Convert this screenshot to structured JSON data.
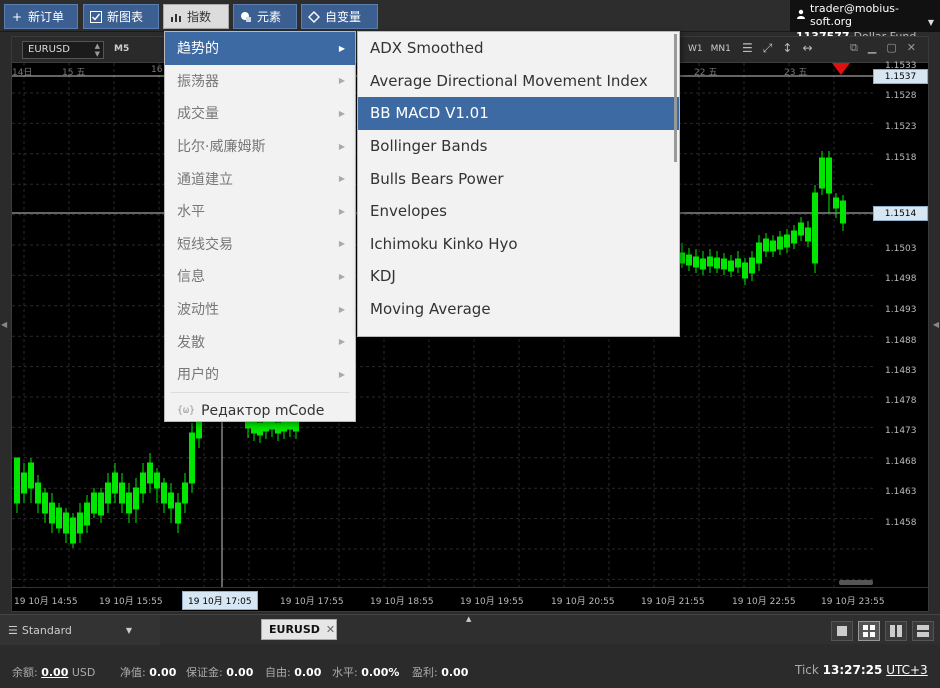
{
  "toolbar": {
    "new_order": "新订单",
    "new_chart": "新图表",
    "indicators": "指数",
    "elements": "元素",
    "variables": "自变量"
  },
  "account": {
    "email": "trader@mobius-soft.org",
    "number": "1137577",
    "fund": "Dollar Fund"
  },
  "chart": {
    "symbol": "EURUSD",
    "timeframe": "M5",
    "timeframes_right": [
      "W1",
      "MN1"
    ],
    "current_price_tag": "1.1537",
    "crosshair_price_tag": "1.1514",
    "price_labels": [
      "1.1533",
      "1.1528",
      "1.1523",
      "1.1518",
      "1.1508",
      "1.1503",
      "1.1498",
      "1.1493",
      "1.1488",
      "1.1483",
      "1.1478",
      "1.1473",
      "1.1468",
      "1.1463",
      "1.1458"
    ],
    "date_labels": [
      "14日",
      "15 五",
      "16",
      "22 五",
      "23 五"
    ],
    "time_labels": [
      "19 10月 14:55",
      "19 10月 15:55",
      "19 10月 17:05",
      "19 10月 17:55",
      "19 10月 18:55",
      "19 10月 19:55",
      "19 10月 20:55",
      "19 10月 21:55",
      "19 10月 22:55",
      "19 10月 23:55"
    ],
    "up_color": "#00e600",
    "down_color": "#00e600"
  },
  "main_menu": {
    "items": [
      {
        "label": "趋势的"
      },
      {
        "label": "振荡器"
      },
      {
        "label": "成交量"
      },
      {
        "label": "比尔·威廉姆斯"
      },
      {
        "label": "通道建立"
      },
      {
        "label": "水平"
      },
      {
        "label": "短线交易"
      },
      {
        "label": "信息"
      },
      {
        "label": "波动性"
      },
      {
        "label": "发散"
      },
      {
        "label": "用户的"
      }
    ],
    "editor": "Редактор mCode",
    "editor_icon": "{ω}"
  },
  "sub_menu": {
    "items": [
      {
        "label": "ADX Smoothed"
      },
      {
        "label": "Average Directional Movement Index"
      },
      {
        "label": "BB MACD V1.01"
      },
      {
        "label": "Bollinger Bands"
      },
      {
        "label": "Bulls Bears Power"
      },
      {
        "label": "Envelopes"
      },
      {
        "label": "Ichimoku Kinko Hyo"
      },
      {
        "label": "KDJ"
      },
      {
        "label": "Moving Average"
      }
    ]
  },
  "tabs": {
    "layout": "Standard",
    "chart_tab": "EURUSD"
  },
  "status": {
    "balance_label": "余额:",
    "balance_value": "0.00",
    "balance_currency": "USD",
    "equity_label": "净值:",
    "equity_value": "0.00",
    "margin_label": "保证金:",
    "margin_value": "0.00",
    "free_label": "自由:",
    "free_value": "0.00",
    "level_label": "水平:",
    "level_value": "0.00%",
    "profit_label": "盈利:",
    "profit_value": "0.00",
    "tick_label": "Tick",
    "time": "13:27:25",
    "timezone": "UTC+3"
  }
}
